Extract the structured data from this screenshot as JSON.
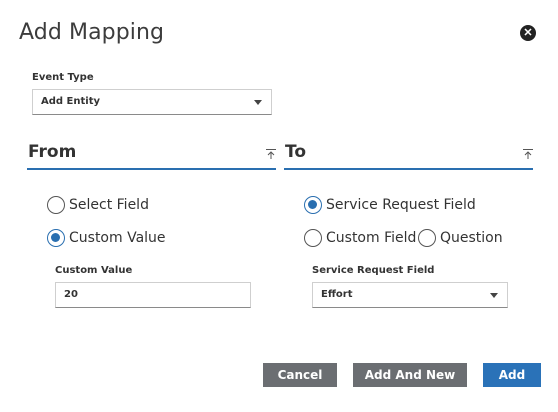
{
  "dialog": {
    "title": "Add Mapping",
    "close_icon": "close-icon"
  },
  "event_type": {
    "label": "Event Type",
    "value": "Add Entity"
  },
  "from": {
    "heading": "From",
    "options": [
      {
        "label": "Select Field",
        "selected": false
      },
      {
        "label": "Custom Value",
        "selected": true
      }
    ],
    "custom_value_label": "Custom Value",
    "custom_value": "20"
  },
  "to": {
    "heading": "To",
    "options": [
      {
        "label": "Service Request Field",
        "selected": true
      },
      {
        "label": "Custom Field",
        "selected": false
      },
      {
        "label": "Question",
        "selected": false
      }
    ],
    "field_label": "Service Request Field",
    "field_value": "Effort"
  },
  "buttons": {
    "cancel": "Cancel",
    "add_and_new": "Add And New",
    "add": "Add"
  },
  "colors": {
    "accent": "#2a6fb0",
    "primary_button": "#2a72b8",
    "secondary_button": "#6b6e72"
  }
}
